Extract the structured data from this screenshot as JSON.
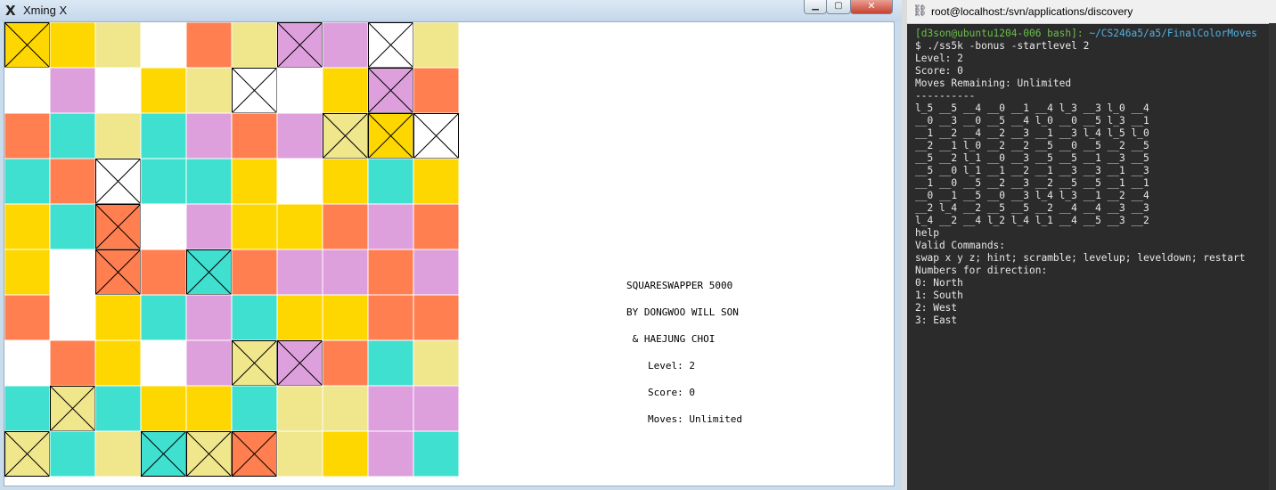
{
  "xwin": {
    "title": "Xming X",
    "min_label": "▁",
    "max_label": "▢",
    "close_label": "✕",
    "icon": "x-logo-icon"
  },
  "board": {
    "colors": {
      "O": "#ff7f50",
      "Y": "#ffd700",
      "K": "#f0e68c",
      "W": "#ffffff",
      "P": "#dda0dd",
      "T": "#40e0d0"
    },
    "rows": [
      [
        {
          "c": "Y",
          "x": true
        },
        {
          "c": "Y",
          "x": false
        },
        {
          "c": "K",
          "x": false
        },
        {
          "c": "W",
          "x": false
        },
        {
          "c": "O",
          "x": false
        },
        {
          "c": "K",
          "x": false
        },
        {
          "c": "P",
          "x": true
        },
        {
          "c": "P",
          "x": false
        },
        {
          "c": "W",
          "x": true
        },
        {
          "c": "K",
          "x": false
        }
      ],
      [
        {
          "c": "W",
          "x": false
        },
        {
          "c": "P",
          "x": false
        },
        {
          "c": "W",
          "x": false
        },
        {
          "c": "Y",
          "x": false
        },
        {
          "c": "K",
          "x": false
        },
        {
          "c": "W",
          "x": true
        },
        {
          "c": "W",
          "x": false
        },
        {
          "c": "Y",
          "x": false
        },
        {
          "c": "P",
          "x": true
        },
        {
          "c": "O",
          "x": false
        }
      ],
      [
        {
          "c": "O",
          "x": false
        },
        {
          "c": "T",
          "x": false
        },
        {
          "c": "K",
          "x": false
        },
        {
          "c": "T",
          "x": false
        },
        {
          "c": "P",
          "x": false
        },
        {
          "c": "O",
          "x": false
        },
        {
          "c": "P",
          "x": false
        },
        {
          "c": "K",
          "x": true
        },
        {
          "c": "Y",
          "x": true
        },
        {
          "c": "W",
          "x": true
        }
      ],
      [
        {
          "c": "T",
          "x": false
        },
        {
          "c": "O",
          "x": false
        },
        {
          "c": "W",
          "x": true
        },
        {
          "c": "T",
          "x": false
        },
        {
          "c": "T",
          "x": false
        },
        {
          "c": "Y",
          "x": false
        },
        {
          "c": "W",
          "x": false
        },
        {
          "c": "Y",
          "x": false
        },
        {
          "c": "T",
          "x": false
        },
        {
          "c": "Y",
          "x": false
        }
      ],
      [
        {
          "c": "Y",
          "x": false
        },
        {
          "c": "T",
          "x": false
        },
        {
          "c": "O",
          "x": true
        },
        {
          "c": "W",
          "x": false
        },
        {
          "c": "P",
          "x": false
        },
        {
          "c": "Y",
          "x": false
        },
        {
          "c": "Y",
          "x": false
        },
        {
          "c": "O",
          "x": false
        },
        {
          "c": "P",
          "x": false
        },
        {
          "c": "O",
          "x": false
        }
      ],
      [
        {
          "c": "Y",
          "x": false
        },
        {
          "c": "W",
          "x": false
        },
        {
          "c": "O",
          "x": true
        },
        {
          "c": "O",
          "x": false
        },
        {
          "c": "T",
          "x": true
        },
        {
          "c": "O",
          "x": false
        },
        {
          "c": "P",
          "x": false
        },
        {
          "c": "P",
          "x": false
        },
        {
          "c": "O",
          "x": false
        },
        {
          "c": "P",
          "x": false
        }
      ],
      [
        {
          "c": "O",
          "x": false
        },
        {
          "c": "W",
          "x": false
        },
        {
          "c": "Y",
          "x": false
        },
        {
          "c": "T",
          "x": false
        },
        {
          "c": "P",
          "x": false
        },
        {
          "c": "T",
          "x": false
        },
        {
          "c": "Y",
          "x": false
        },
        {
          "c": "Y",
          "x": false
        },
        {
          "c": "O",
          "x": false
        },
        {
          "c": "O",
          "x": false
        }
      ],
      [
        {
          "c": "W",
          "x": false
        },
        {
          "c": "O",
          "x": false
        },
        {
          "c": "Y",
          "x": false
        },
        {
          "c": "W",
          "x": false
        },
        {
          "c": "P",
          "x": false
        },
        {
          "c": "K",
          "x": true
        },
        {
          "c": "P",
          "x": true
        },
        {
          "c": "O",
          "x": false
        },
        {
          "c": "T",
          "x": false
        },
        {
          "c": "K",
          "x": false
        }
      ],
      [
        {
          "c": "T",
          "x": false
        },
        {
          "c": "K",
          "x": true
        },
        {
          "c": "T",
          "x": false
        },
        {
          "c": "Y",
          "x": false
        },
        {
          "c": "Y",
          "x": false
        },
        {
          "c": "T",
          "x": false
        },
        {
          "c": "K",
          "x": false
        },
        {
          "c": "K",
          "x": false
        },
        {
          "c": "P",
          "x": false
        },
        {
          "c": "P",
          "x": false
        }
      ],
      [
        {
          "c": "K",
          "x": true
        },
        {
          "c": "T",
          "x": false
        },
        {
          "c": "K",
          "x": false
        },
        {
          "c": "T",
          "x": true
        },
        {
          "c": "K",
          "x": true
        },
        {
          "c": "O",
          "x": true
        },
        {
          "c": "K",
          "x": false
        },
        {
          "c": "Y",
          "x": false
        },
        {
          "c": "P",
          "x": false
        },
        {
          "c": "T",
          "x": false
        }
      ]
    ]
  },
  "info": {
    "title": "SQUARESWAPPER 5000",
    "by": "BY DONGWOO WILL SON",
    "and": " & HAEJUNG CHOI",
    "level": "Level: 2",
    "score": "Score: 0",
    "moves": "Moves: Unlimited"
  },
  "terminal": {
    "title": "root@localhost:/svn/applications/discovery",
    "icon": "putty-icon",
    "prompt_user": "[d3son@ubuntu1204-006 bash]: ",
    "prompt_path": "~/CS246a5/a5/FinalColorMoves",
    "lines": [
      "$ ./ss5k -bonus -startlevel 2",
      "Level: 2",
      "Score: 0",
      "Moves Remaining: Unlimited",
      "----------",
      "l_5 __5 __4 __0 __1 __4 l_3 __3 l_0 __4",
      "__0 __3 __0 __5 __4 l_0 __0 __5 l_3 __1",
      "__1 __2 __4 __2 __3 __1 __3 l_4 l_5 l_0",
      "__2 __1 l_0 __2 __2 __5 __0 __5 __2 __5",
      "__5 __2 l_1 __0 __3 __5 __5 __1 __3 __5",
      "__5 __0 l_1 __1 __2 __1 __3 __3 __1 __3",
      "__1 __0 __5 __2 __3 __2 __5 __5 __1 __1",
      "__0 __1 __5 __0 __3 l_4 l_3 __1 __2 __4",
      "__2 l_4 __2 __5 __5 __2 __4 __4 __3 __3",
      "l_4 __2 __4 l_2 l_4 l_1 __4 __5 __3 __2",
      "help",
      "Valid Commands:",
      "swap x y z; hint; scramble; levelup; leveldown; restart",
      "Numbers for direction:",
      "0: North",
      "1: South",
      "2: West",
      "3: East"
    ]
  }
}
